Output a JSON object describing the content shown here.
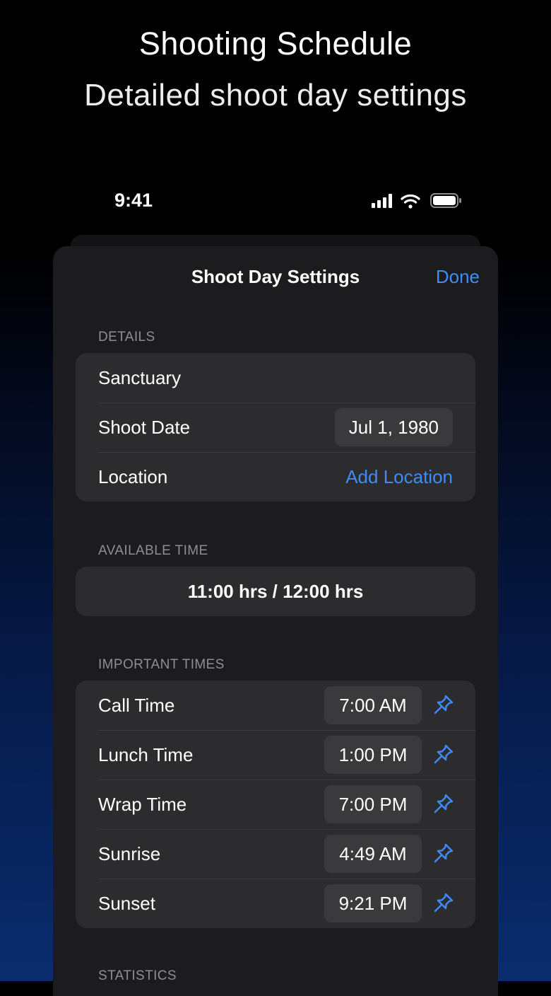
{
  "promo": {
    "title": "Shooting Schedule",
    "subtitle": "Detailed shoot day settings"
  },
  "status_bar": {
    "time": "9:41",
    "icons": [
      "cellular-signal-icon",
      "wifi-icon",
      "battery-icon"
    ]
  },
  "sheet": {
    "title": "Shoot Day Settings",
    "done_label": "Done"
  },
  "details": {
    "header": "DETAILS",
    "name": "Sanctuary",
    "shoot_date_label": "Shoot Date",
    "shoot_date_value": "Jul 1, 1980",
    "location_label": "Location",
    "location_action": "Add Location"
  },
  "available_time": {
    "header": "AVAILABLE TIME",
    "value": "11:00 hrs / 12:00 hrs"
  },
  "important_times": {
    "header": "IMPORTANT TIMES",
    "rows": [
      {
        "label": "Call Time",
        "value": "7:00 AM"
      },
      {
        "label": "Lunch Time",
        "value": "1:00 PM"
      },
      {
        "label": "Wrap Time",
        "value": "7:00 PM"
      },
      {
        "label": "Sunrise",
        "value": "4:49 AM"
      },
      {
        "label": "Sunset",
        "value": "9:21 PM"
      }
    ]
  },
  "statistics": {
    "header": "STATISTICS"
  },
  "colors": {
    "accent": "#3d8df5",
    "sheet_bg": "#1c1c1e",
    "group_bg": "#2c2c2e",
    "pill_bg": "#3a3a3c",
    "secondary_text": "#8e8e93"
  }
}
